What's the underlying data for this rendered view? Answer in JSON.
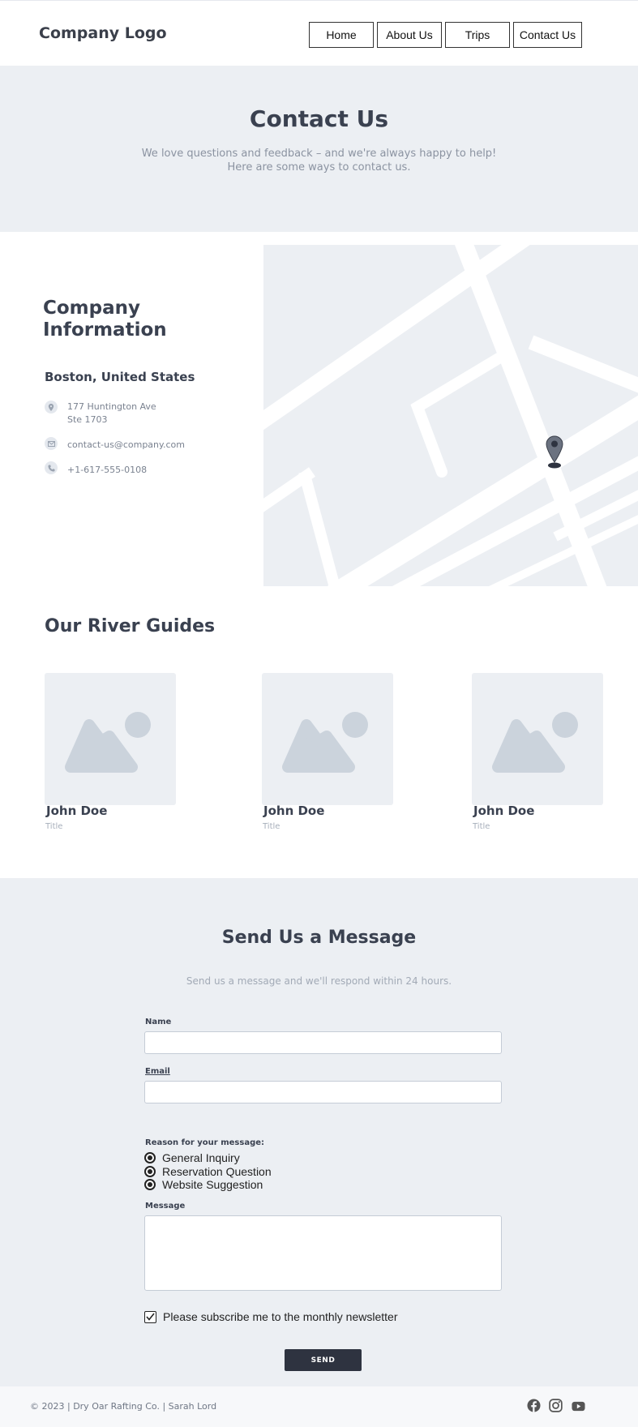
{
  "header": {
    "logo": "Company Logo",
    "nav": [
      "Home",
      "About Us",
      "Trips",
      "Contact Us"
    ]
  },
  "hero": {
    "title": "Contact Us",
    "line1": "We love questions and feedback – and we're always happy to help!",
    "line2": "Here are some ways to contact us."
  },
  "company": {
    "title_line1": "Company",
    "title_line2": "Information",
    "city": "Boston, United States",
    "address_line1": "177 Huntington Ave",
    "address_line2": "Ste 1703",
    "email": "contact-us@company.com",
    "phone": "+1-617-555-0108"
  },
  "guides": {
    "title": "Our River Guides",
    "items": [
      {
        "name": "John Doe",
        "title": "Title"
      },
      {
        "name": "John Doe",
        "title": "Title"
      },
      {
        "name": "John Doe",
        "title": "Title"
      }
    ]
  },
  "form": {
    "title": "Send Us a Message",
    "subtitle": "Send us a message and we'll respond within 24 hours.",
    "name_label": "Name",
    "email_label": "Email",
    "reason_label": "Reason for your message:",
    "reasons": [
      "General Inquiry",
      "Reservation Question",
      "Website Suggestion"
    ],
    "message_label": "Message",
    "newsletter_label": "Please subscribe me to the monthly newsletter",
    "newsletter_checked": true,
    "send_label": "SEND"
  },
  "footer": {
    "copyright": "© 2023 | Dry Oar Rafting Co. | Sarah Lord",
    "social": [
      "facebook-icon",
      "instagram-icon",
      "youtube-icon"
    ]
  }
}
